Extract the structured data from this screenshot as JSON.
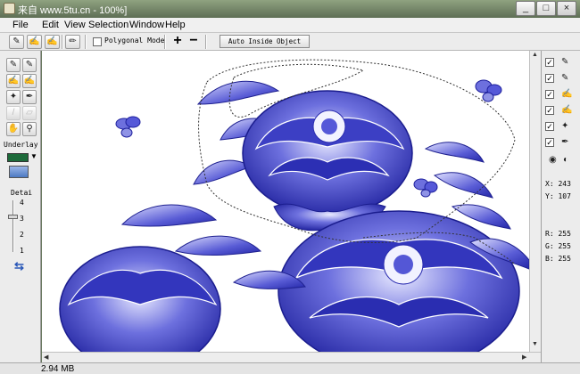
{
  "window": {
    "title": "来自 www.5tu.cn - 100%]",
    "minimize": "_",
    "maximize": "□",
    "close": "×"
  },
  "menu": [
    "File",
    "Edit",
    "View",
    "Selection",
    "Window",
    "Help"
  ],
  "toolbar": {
    "polygonal_mode_label": "Polygonal Mode",
    "plus_label": "+",
    "minus_label": "−",
    "auto_inside_label": "Auto Inside Object"
  },
  "left_panel": {
    "underlay_label": "Underlay",
    "underlay_color": "#1d6a3a",
    "detail_label": "Detai",
    "ticks": [
      "4",
      "3",
      "2",
      "1"
    ],
    "detail_value": 3
  },
  "right_panel": {
    "x_label": "X: 243",
    "y_label": "Y: 107",
    "r_label": "R: 255",
    "g_label": "G: 255",
    "b_label": "B: 255"
  },
  "status": {
    "size": "2.94 MB"
  },
  "colors": {
    "ink": "#2d2fb0",
    "ink_light": "#8f93e6"
  }
}
